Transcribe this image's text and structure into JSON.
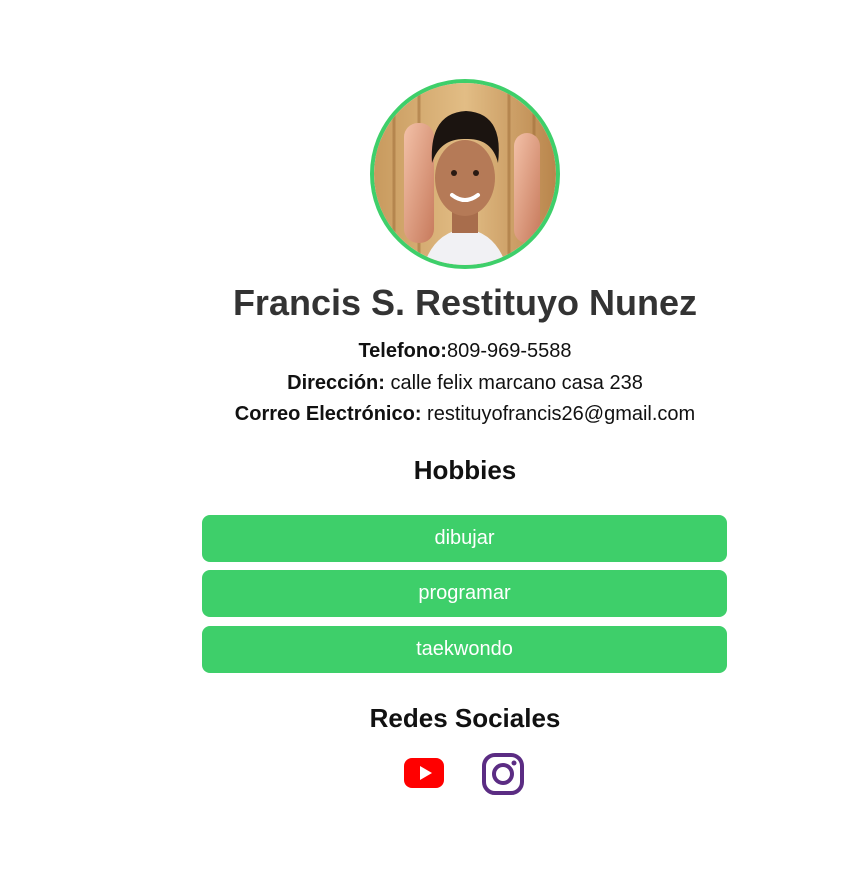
{
  "profile": {
    "name": "Francis S. Restituyo Nunez",
    "phone_label": "Telefono:",
    "phone_value": "809-969-5588",
    "address_label": "Dirección:",
    "address_value": " calle felix marcano casa 238",
    "email_label": "Correo Electrónico:",
    "email_value": " restituyofrancis26@gmail.com"
  },
  "hobbies": {
    "title": "Hobbies",
    "items": [
      "dibujar",
      "programar",
      "taekwondo"
    ]
  },
  "social": {
    "title": "Redes Sociales",
    "icons": [
      "youtube-icon",
      "instagram-icon"
    ]
  },
  "colors": {
    "accent": "#3ecf6a",
    "youtube": "#ff0000",
    "instagram": "#5b2c83"
  }
}
